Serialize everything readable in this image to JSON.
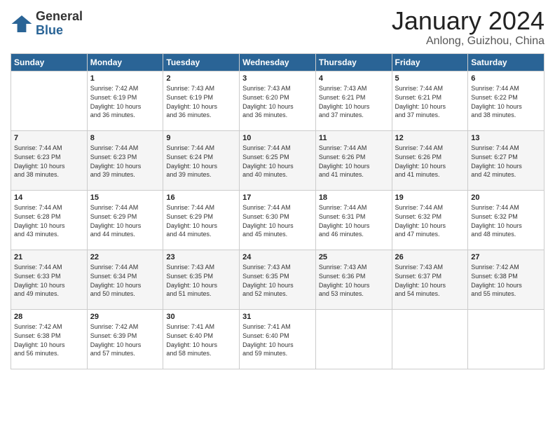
{
  "logo": {
    "general": "General",
    "blue": "Blue"
  },
  "title": "January 2024",
  "location": "Anlong, Guizhou, China",
  "weekdays": [
    "Sunday",
    "Monday",
    "Tuesday",
    "Wednesday",
    "Thursday",
    "Friday",
    "Saturday"
  ],
  "weeks": [
    [
      {
        "day": "",
        "sunrise": "",
        "sunset": "",
        "daylight": ""
      },
      {
        "day": "1",
        "sunrise": "Sunrise: 7:42 AM",
        "sunset": "Sunset: 6:19 PM",
        "daylight": "Daylight: 10 hours and 36 minutes."
      },
      {
        "day": "2",
        "sunrise": "Sunrise: 7:43 AM",
        "sunset": "Sunset: 6:19 PM",
        "daylight": "Daylight: 10 hours and 36 minutes."
      },
      {
        "day": "3",
        "sunrise": "Sunrise: 7:43 AM",
        "sunset": "Sunset: 6:20 PM",
        "daylight": "Daylight: 10 hours and 36 minutes."
      },
      {
        "day": "4",
        "sunrise": "Sunrise: 7:43 AM",
        "sunset": "Sunset: 6:21 PM",
        "daylight": "Daylight: 10 hours and 37 minutes."
      },
      {
        "day": "5",
        "sunrise": "Sunrise: 7:44 AM",
        "sunset": "Sunset: 6:21 PM",
        "daylight": "Daylight: 10 hours and 37 minutes."
      },
      {
        "day": "6",
        "sunrise": "Sunrise: 7:44 AM",
        "sunset": "Sunset: 6:22 PM",
        "daylight": "Daylight: 10 hours and 38 minutes."
      }
    ],
    [
      {
        "day": "7",
        "sunrise": "Sunrise: 7:44 AM",
        "sunset": "Sunset: 6:23 PM",
        "daylight": "Daylight: 10 hours and 38 minutes."
      },
      {
        "day": "8",
        "sunrise": "Sunrise: 7:44 AM",
        "sunset": "Sunset: 6:23 PM",
        "daylight": "Daylight: 10 hours and 39 minutes."
      },
      {
        "day": "9",
        "sunrise": "Sunrise: 7:44 AM",
        "sunset": "Sunset: 6:24 PM",
        "daylight": "Daylight: 10 hours and 39 minutes."
      },
      {
        "day": "10",
        "sunrise": "Sunrise: 7:44 AM",
        "sunset": "Sunset: 6:25 PM",
        "daylight": "Daylight: 10 hours and 40 minutes."
      },
      {
        "day": "11",
        "sunrise": "Sunrise: 7:44 AM",
        "sunset": "Sunset: 6:26 PM",
        "daylight": "Daylight: 10 hours and 41 minutes."
      },
      {
        "day": "12",
        "sunrise": "Sunrise: 7:44 AM",
        "sunset": "Sunset: 6:26 PM",
        "daylight": "Daylight: 10 hours and 41 minutes."
      },
      {
        "day": "13",
        "sunrise": "Sunrise: 7:44 AM",
        "sunset": "Sunset: 6:27 PM",
        "daylight": "Daylight: 10 hours and 42 minutes."
      }
    ],
    [
      {
        "day": "14",
        "sunrise": "Sunrise: 7:44 AM",
        "sunset": "Sunset: 6:28 PM",
        "daylight": "Daylight: 10 hours and 43 minutes."
      },
      {
        "day": "15",
        "sunrise": "Sunrise: 7:44 AM",
        "sunset": "Sunset: 6:29 PM",
        "daylight": "Daylight: 10 hours and 44 minutes."
      },
      {
        "day": "16",
        "sunrise": "Sunrise: 7:44 AM",
        "sunset": "Sunset: 6:29 PM",
        "daylight": "Daylight: 10 hours and 44 minutes."
      },
      {
        "day": "17",
        "sunrise": "Sunrise: 7:44 AM",
        "sunset": "Sunset: 6:30 PM",
        "daylight": "Daylight: 10 hours and 45 minutes."
      },
      {
        "day": "18",
        "sunrise": "Sunrise: 7:44 AM",
        "sunset": "Sunset: 6:31 PM",
        "daylight": "Daylight: 10 hours and 46 minutes."
      },
      {
        "day": "19",
        "sunrise": "Sunrise: 7:44 AM",
        "sunset": "Sunset: 6:32 PM",
        "daylight": "Daylight: 10 hours and 47 minutes."
      },
      {
        "day": "20",
        "sunrise": "Sunrise: 7:44 AM",
        "sunset": "Sunset: 6:32 PM",
        "daylight": "Daylight: 10 hours and 48 minutes."
      }
    ],
    [
      {
        "day": "21",
        "sunrise": "Sunrise: 7:44 AM",
        "sunset": "Sunset: 6:33 PM",
        "daylight": "Daylight: 10 hours and 49 minutes."
      },
      {
        "day": "22",
        "sunrise": "Sunrise: 7:44 AM",
        "sunset": "Sunset: 6:34 PM",
        "daylight": "Daylight: 10 hours and 50 minutes."
      },
      {
        "day": "23",
        "sunrise": "Sunrise: 7:43 AM",
        "sunset": "Sunset: 6:35 PM",
        "daylight": "Daylight: 10 hours and 51 minutes."
      },
      {
        "day": "24",
        "sunrise": "Sunrise: 7:43 AM",
        "sunset": "Sunset: 6:35 PM",
        "daylight": "Daylight: 10 hours and 52 minutes."
      },
      {
        "day": "25",
        "sunrise": "Sunrise: 7:43 AM",
        "sunset": "Sunset: 6:36 PM",
        "daylight": "Daylight: 10 hours and 53 minutes."
      },
      {
        "day": "26",
        "sunrise": "Sunrise: 7:43 AM",
        "sunset": "Sunset: 6:37 PM",
        "daylight": "Daylight: 10 hours and 54 minutes."
      },
      {
        "day": "27",
        "sunrise": "Sunrise: 7:42 AM",
        "sunset": "Sunset: 6:38 PM",
        "daylight": "Daylight: 10 hours and 55 minutes."
      }
    ],
    [
      {
        "day": "28",
        "sunrise": "Sunrise: 7:42 AM",
        "sunset": "Sunset: 6:38 PM",
        "daylight": "Daylight: 10 hours and 56 minutes."
      },
      {
        "day": "29",
        "sunrise": "Sunrise: 7:42 AM",
        "sunset": "Sunset: 6:39 PM",
        "daylight": "Daylight: 10 hours and 57 minutes."
      },
      {
        "day": "30",
        "sunrise": "Sunrise: 7:41 AM",
        "sunset": "Sunset: 6:40 PM",
        "daylight": "Daylight: 10 hours and 58 minutes."
      },
      {
        "day": "31",
        "sunrise": "Sunrise: 7:41 AM",
        "sunset": "Sunset: 6:40 PM",
        "daylight": "Daylight: 10 hours and 59 minutes."
      },
      {
        "day": "",
        "sunrise": "",
        "sunset": "",
        "daylight": ""
      },
      {
        "day": "",
        "sunrise": "",
        "sunset": "",
        "daylight": ""
      },
      {
        "day": "",
        "sunrise": "",
        "sunset": "",
        "daylight": ""
      }
    ]
  ]
}
